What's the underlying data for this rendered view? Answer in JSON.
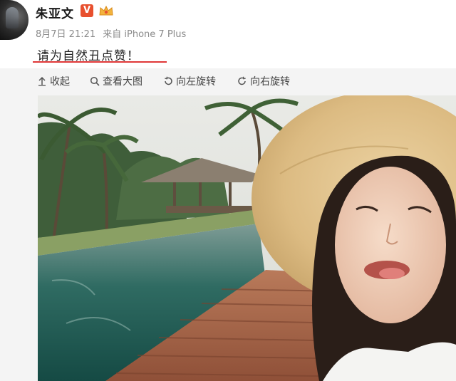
{
  "post": {
    "username": "朱亚文",
    "verified_badge": "V",
    "date": "8月7日 21:21",
    "source": "来自 iPhone 7 Plus",
    "text": "请为自然丑点赞！"
  },
  "toolbar": {
    "collapse_label": "收起",
    "view_large_label": "查看大图",
    "rotate_left_label": "向左旋转",
    "rotate_right_label": "向右旋转"
  },
  "colors": {
    "accent_underline": "#e03838",
    "verified_badge": "#e8502e",
    "meta_text": "#8a8a8a"
  },
  "icons": [
    "collapse-icon",
    "magnifier-icon",
    "rotate-left-icon",
    "rotate-right-icon",
    "crown-icon"
  ]
}
